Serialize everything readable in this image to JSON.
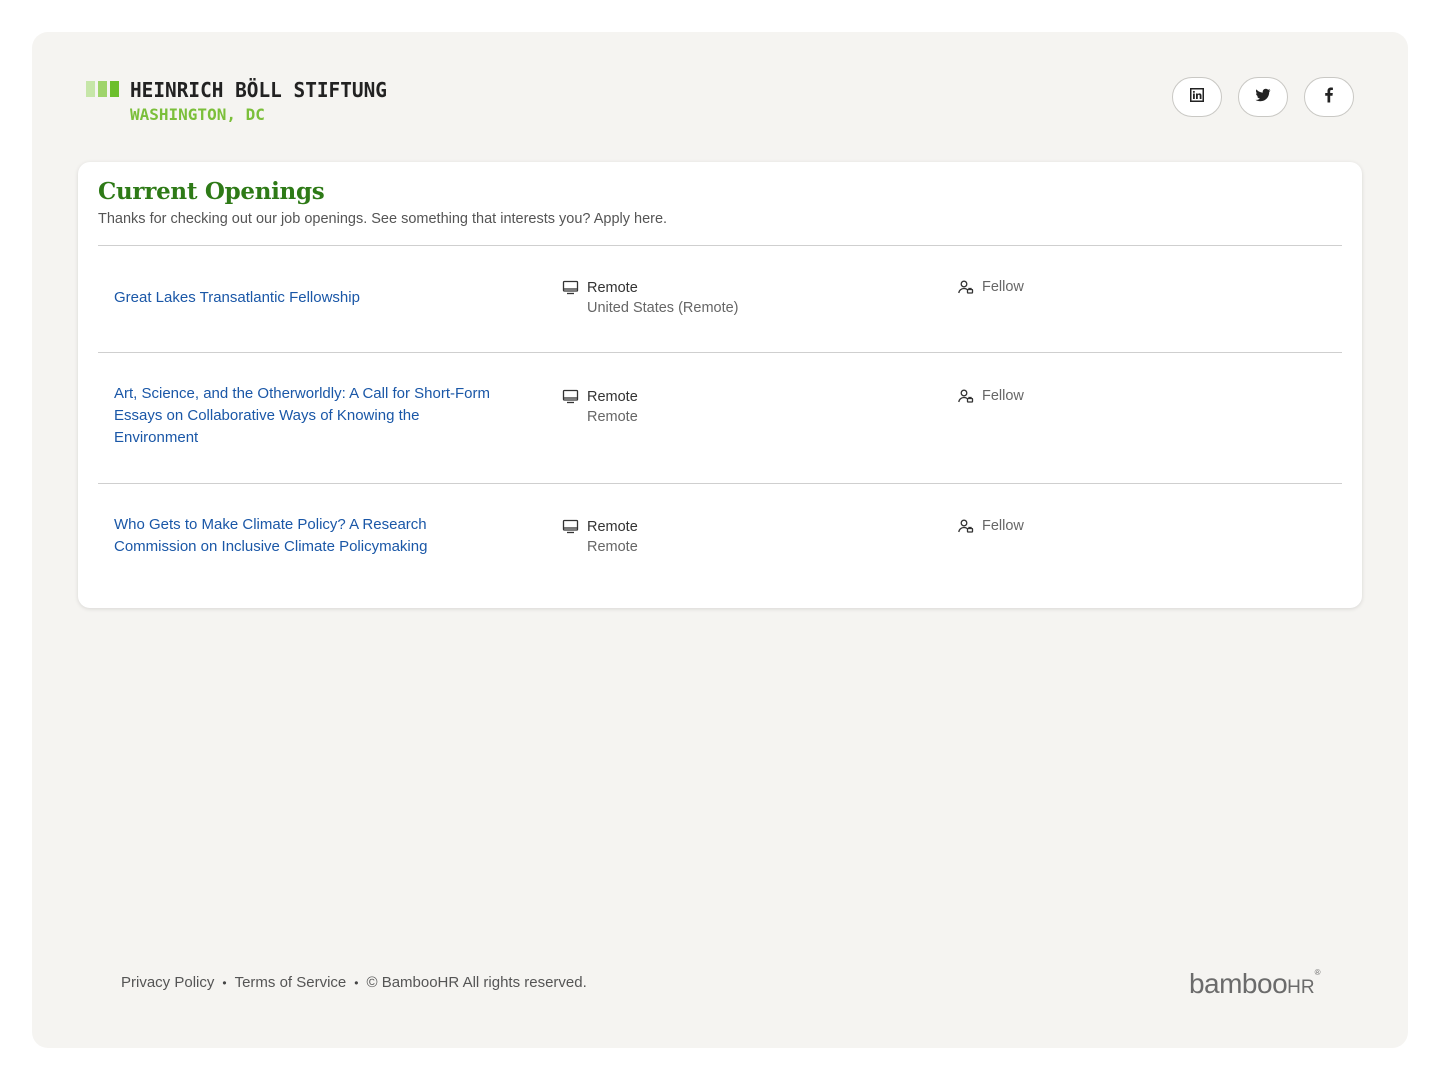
{
  "brand": {
    "name_line1": "HEINRICH BÖLL STIFTUNG",
    "name_line2": "WASHINGTON, DC",
    "bar_colors": [
      "#c6e6a8",
      "#9fd46b",
      "#6cbf2d"
    ]
  },
  "socials": [
    {
      "icon": "linkedin-icon"
    },
    {
      "icon": "twitter-icon"
    },
    {
      "icon": "facebook-icon"
    }
  ],
  "openings": {
    "title": "Current Openings",
    "subtitle": "Thanks for checking out our job openings. See something that interests you? Apply here.",
    "jobs": [
      {
        "title": "Great Lakes Transatlantic Fellowship",
        "location_type": "Remote",
        "location": "United States (Remote)",
        "employment": "Fellow"
      },
      {
        "title": "Art, Science, and the Otherworldly: A Call for Short-Form Essays on Collaborative Ways of Knowing the Environment",
        "location_type": "Remote",
        "location": "Remote",
        "employment": "Fellow"
      },
      {
        "title": "Who Gets to Make Climate Policy? A Research Commission on Inclusive Climate Policymaking",
        "location_type": "Remote",
        "location": "Remote",
        "employment": "Fellow"
      }
    ]
  },
  "footer": {
    "privacy": "Privacy Policy",
    "terms": "Terms of Service",
    "copyright": "© BambooHR All rights reserved.",
    "logo_main": "bamboo",
    "logo_hr": "HR",
    "logo_tm": "®"
  },
  "colors": {
    "accent_green": "#2e7a17",
    "link_blue": "#1a57a7",
    "background": "#f5f4f1"
  }
}
